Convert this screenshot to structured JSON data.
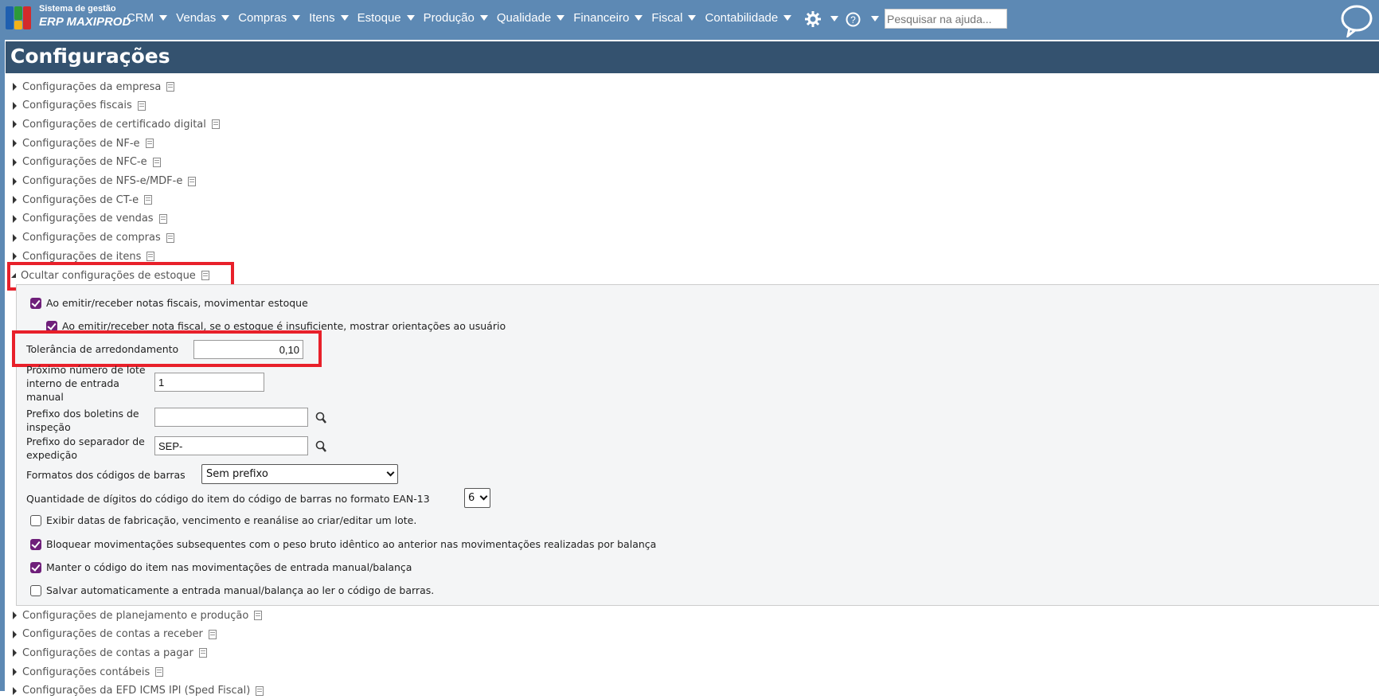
{
  "brand": {
    "line1": "Sistema de gestão",
    "line2": "ERP MAXIPROD",
    "logo_colors": [
      "#1f5fb0",
      "#2d9a3a",
      "#f2b21b",
      "#d32b2b"
    ]
  },
  "nav": {
    "menus": [
      "CRM",
      "Vendas",
      "Compras",
      "Itens",
      "Estoque",
      "Produção",
      "Qualidade",
      "Financeiro",
      "Fiscal",
      "Contabilidade"
    ],
    "search_placeholder": "Pesquisar na ajuda...",
    "icons": [
      "gear-icon",
      "help-icon",
      "chat-bubble-icon"
    ]
  },
  "page": {
    "title": "Configurações"
  },
  "sections_before": [
    "Configurações da empresa",
    "Configurações fiscais",
    "Configurações de certificado digital",
    "Configurações de NF-e",
    "Configurações de NFC-e",
    "Configurações de NFS-e/MDF-e",
    "Configurações de CT-e",
    "Configurações de vendas",
    "Configurações de compras",
    "Configurações de itens"
  ],
  "expanded": {
    "toggle_label": "Ocultar configurações de estoque",
    "cb_movimentar": {
      "label": "Ao emitir/receber notas fiscais, movimentar estoque",
      "checked": true
    },
    "cb_orientacoes": {
      "label": "Ao emitir/receber nota fiscal, se o estoque é insuficiente, mostrar orientações ao usuário",
      "checked": true
    },
    "tolerancia": {
      "label": "Tolerância de arredondamento",
      "value": "0,10"
    },
    "lote": {
      "label": "Próximo número de lote interno de entrada manual",
      "value": "1"
    },
    "boletins": {
      "label": "Prefixo dos boletins de inspeção",
      "value": ""
    },
    "separador": {
      "label": "Prefixo do separador de expedição",
      "value": "SEP-"
    },
    "formatos": {
      "label": "Formatos dos códigos de barras",
      "value": "Sem prefixo"
    },
    "digitos": {
      "label": "Quantidade de dígitos do código do item do código de barras no formato EAN-13",
      "value": "6"
    },
    "checks": [
      {
        "label": "Exibir datas de fabricação, vencimento e reanálise ao criar/editar um lote.",
        "checked": false
      },
      {
        "label": "Bloquear movimentações subsequentes com o peso bruto idêntico ao anterior nas movimentações realizadas por balança",
        "checked": true
      },
      {
        "label": "Manter o código do item nas movimentações de entrada manual/balança",
        "checked": true
      },
      {
        "label": "Salvar automaticamente a entrada manual/balança ao ler o código de barras.",
        "checked": false
      }
    ]
  },
  "sections_after": [
    "Configurações de planejamento e produção",
    "Configurações de contas a receber",
    "Configurações de contas a pagar",
    "Configurações contábeis",
    "Configurações da EFD ICMS IPI (Sped Fiscal)"
  ],
  "colors": {
    "nav": "#5d89b4",
    "title_bar": "#34526f",
    "highlight": "#e8202a",
    "checkbox": "#6f1f7a"
  }
}
